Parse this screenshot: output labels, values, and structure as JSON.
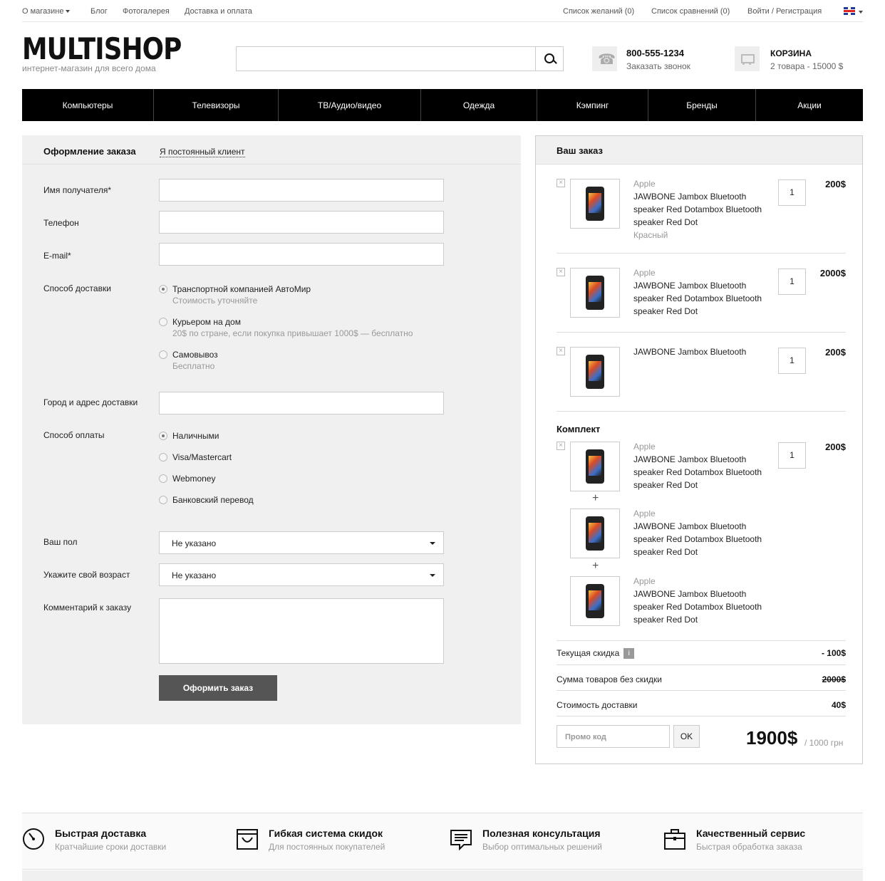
{
  "topbar": {
    "about": "О магазине",
    "blog": "Блог",
    "gallery": "Фотогалерея",
    "delivery": "Доставка и оплата",
    "wishlist": "Список желаний (0)",
    "compare": "Список сравнений (0)",
    "login": "Войти / Регистрация"
  },
  "header": {
    "logo": "MULTISHOP",
    "tagline": "интернет-магазин для всего дома",
    "search_placeholder": "",
    "phone": "800-555-1234",
    "callback": "Заказать звонок",
    "cart_title": "КОРЗИНА",
    "cart_summary": "2 товара - 15000 $"
  },
  "nav": [
    "Компьютеры",
    "Телевизоры",
    "ТВ/Аудио/видео",
    "Одежда",
    "Кэмпинг",
    "Бренды",
    "Акции"
  ],
  "form": {
    "title": "Оформление заказа",
    "regular_client": "Я постоянный клиент",
    "name_label": "Имя получателя*",
    "phone_label": "Телефон",
    "email_label": "E-mail*",
    "delivery_label": "Способ доставки",
    "delivery_options": [
      {
        "label": "Транспортной компанией АвтоМир",
        "sub": "Стоимость уточняйте",
        "selected": true
      },
      {
        "label": "Курьером на дом",
        "sub": "20$ по стране, если покупка привышает 1000$ — бесплатно",
        "selected": false
      },
      {
        "label": "Самовывоз",
        "sub": "Бесплатно",
        "selected": false
      }
    ],
    "address_label": "Город и адрес доставки",
    "payment_label": "Способ оплаты",
    "payment_options": [
      {
        "label": "Наличными",
        "selected": true
      },
      {
        "label": "Visa/Mastercart",
        "selected": false
      },
      {
        "label": "Webmoney",
        "selected": false
      },
      {
        "label": "Банковский перевод",
        "selected": false
      }
    ],
    "gender_label": "Ваш пол",
    "gender_value": "Не указано",
    "age_label": "Укажите свой возраст",
    "age_value": "Не указано",
    "comment_label": "Комментарий к заказу",
    "submit": "Оформить заказ"
  },
  "order": {
    "title": "Ваш заказ",
    "items": [
      {
        "brand": "Apple",
        "name": "JAWBONE Jambox Bluetooth speaker Red Dotambox Bluetooth speaker Red Dot",
        "color": "Красный",
        "qty": "1",
        "price": "200$"
      },
      {
        "brand": "Apple",
        "name": "JAWBONE Jambox Bluetooth speaker Red Dotambox Bluetooth speaker Red Dot",
        "qty": "1",
        "price": "2000$"
      },
      {
        "name": "JAWBONE Jambox Bluetooth",
        "qty": "1",
        "price": "200$"
      }
    ],
    "kit_title": "Комплект",
    "kit_items": [
      {
        "brand": "Apple",
        "name": "JAWBONE Jambox Bluetooth speaker Red Dotambox Bluetooth speaker Red Dot",
        "qty": "1",
        "price": "200$"
      },
      {
        "brand": "Apple",
        "name": "JAWBONE Jambox Bluetooth speaker Red Dotambox Bluetooth speaker Red Dot"
      },
      {
        "brand": "Apple",
        "name": "JAWBONE Jambox Bluetooth speaker Red Dotambox Bluetooth speaker Red Dot"
      }
    ],
    "plus": "+",
    "discount_label": "Текущая скидка",
    "discount_value": "- 100$",
    "subtotal_label": "Сумма товаров без скидки",
    "subtotal_value": "2000$",
    "shipping_label": "Стоимость доставки",
    "shipping_value": "40$",
    "promo_placeholder": "Промо код",
    "ok": "OK",
    "total": "1900$",
    "total_sub": "/ 1000 грн"
  },
  "footer": [
    {
      "icon": "speedometer-icon",
      "title": "Быстрая доставка",
      "sub": "Кратчайшие сроки доставки"
    },
    {
      "icon": "discount-bag-icon",
      "title": "Гибкая система скидок",
      "sub": "Для постоянных покупателей"
    },
    {
      "icon": "chat-icon",
      "title": "Полезная консультация",
      "sub": "Выбор оптимальных решений"
    },
    {
      "icon": "briefcase-icon",
      "title": "Качественный сервис",
      "sub": "Быстрая обработка заказа"
    }
  ]
}
